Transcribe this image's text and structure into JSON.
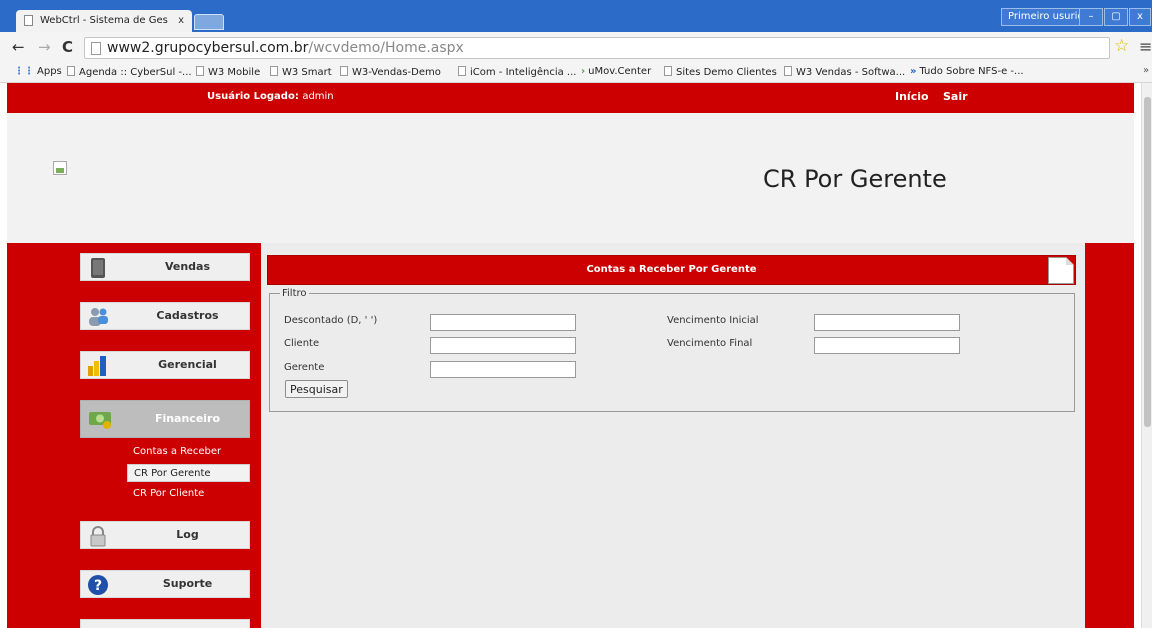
{
  "browser": {
    "tab_title": "WebCtrl - Sistema de Ges",
    "tab_close": "x",
    "profile": "Primeiro usurio",
    "window_buttons": [
      "–",
      "▢",
      "x"
    ],
    "url_host": "www2.grupocybersul.com.br",
    "url_path": "/wcvdemo/Home.aspx",
    "bookmarks": [
      "Apps",
      "Agenda :: CyberSul -...",
      "W3 Mobile",
      "W3 Smart",
      "W3-Vendas-Demo",
      "iCom - Inteligência ...",
      "uMov.Center",
      "Sites Demo Clientes",
      "W3 Vendas - Softwa...",
      "Tudo Sobre NFS-e -..."
    ],
    "bookmarks_more": "»"
  },
  "topbar": {
    "user_label": "Usuário Logado:",
    "user_value": "admin",
    "inicio": "Início",
    "sair": "Sair"
  },
  "header": {
    "title": "CR Por Gerente"
  },
  "sidebar": {
    "items": [
      {
        "label": "Vendas",
        "icon": "tablet-icon"
      },
      {
        "label": "Cadastros",
        "icon": "users-icon"
      },
      {
        "label": "Gerencial",
        "icon": "bar-chart-icon"
      },
      {
        "label": "Financeiro",
        "icon": "money-icon"
      },
      {
        "label": "Log",
        "icon": "lock-icon"
      },
      {
        "label": "Suporte",
        "icon": "help-icon"
      }
    ],
    "financeiro_sub": [
      "Contas a Receber",
      "CR Por Gerente",
      "CR Por Cliente"
    ]
  },
  "panel": {
    "title": "Contas a Receber Por Gerente",
    "filter_legend": "Filtro",
    "fields": {
      "descontado": "Descontado (D, ' ')",
      "cliente": "Cliente",
      "gerente": "Gerente",
      "venc_inicial": "Vencimento Inicial",
      "venc_final": "Vencimento Final"
    },
    "values": {
      "descontado": "",
      "cliente": "",
      "gerente": "",
      "venc_inicial": "",
      "venc_final": ""
    },
    "search_button": "Pesquisar"
  },
  "colors": {
    "accent_red": "#cc0000",
    "browser_blue": "#2d6bc8"
  }
}
